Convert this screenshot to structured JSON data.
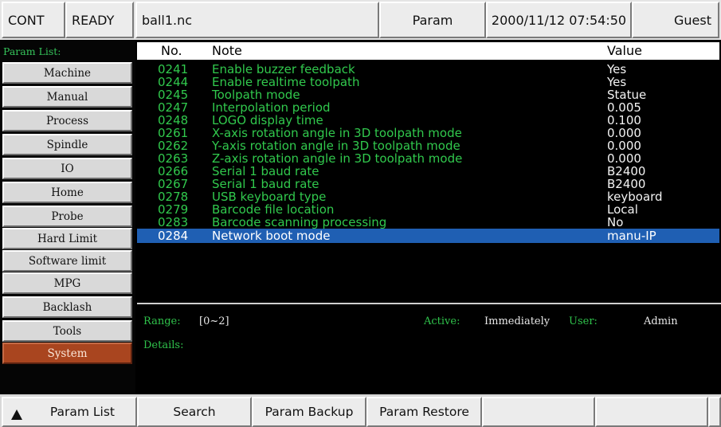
{
  "status_bar": {
    "mode": "CONT",
    "state": "READY",
    "file": "ball1.nc",
    "screen": "Param",
    "datetime": "2000/11/12 07:54:50",
    "user": "Guest"
  },
  "sidebar": {
    "title": "Param List:",
    "items": [
      {
        "label": "Machine"
      },
      {
        "label": "Manual"
      },
      {
        "label": "Process"
      },
      {
        "label": "Spindle"
      },
      {
        "label": "IO"
      },
      {
        "label": "Home"
      },
      {
        "label": "Probe"
      },
      {
        "label": "Hard Limit"
      },
      {
        "label": "Software limit"
      },
      {
        "label": "MPG"
      },
      {
        "label": "Backlash"
      },
      {
        "label": "Tools"
      },
      {
        "label": "System"
      }
    ],
    "active_index": 12
  },
  "table": {
    "headers": {
      "no": "No.",
      "note": "Note",
      "value": "Value"
    },
    "rows": [
      {
        "no": "0241",
        "note": "Enable buzzer feedback",
        "value": "Yes"
      },
      {
        "no": "0244",
        "note": "Enable realtime toolpath",
        "value": "Yes"
      },
      {
        "no": "0245",
        "note": "Toolpath mode",
        "value": "Statue"
      },
      {
        "no": "0247",
        "note": "Interpolation period",
        "value": "0.005"
      },
      {
        "no": "0248",
        "note": "LOGO display time",
        "value": "0.100"
      },
      {
        "no": "0261",
        "note": "X-axis rotation angle in 3D toolpath mode",
        "value": "0.000"
      },
      {
        "no": "0262",
        "note": "Y-axis rotation angle in 3D toolpath mode",
        "value": "0.000"
      },
      {
        "no": "0263",
        "note": "Z-axis rotation angle in 3D toolpath mode",
        "value": "0.000"
      },
      {
        "no": "0266",
        "note": "Serial 1 baud rate",
        "value": "B2400"
      },
      {
        "no": "0267",
        "note": "Serial 1 baud rate",
        "value": "B2400"
      },
      {
        "no": "0278",
        "note": "USB keyboard type",
        "value": "keyboard"
      },
      {
        "no": "0279",
        "note": "Barcode file location",
        "value": "Local"
      },
      {
        "no": "0283",
        "note": "Barcode scanning processing",
        "value": "No"
      },
      {
        "no": "0284",
        "note": "Network boot mode",
        "value": "manu-IP"
      }
    ],
    "selected_index": 13
  },
  "detail": {
    "range_label": "Range:",
    "range_value": "[0~2]",
    "active_label": "Active:",
    "active_value": "Immediately",
    "user_label": "User:",
    "user_value": "Admin",
    "details_label": "Details:"
  },
  "function_keys": [
    "Param List",
    "Search",
    "Param Backup",
    "Param Restore",
    "",
    "",
    ""
  ],
  "colors": {
    "text_green": "#31c94d",
    "selected_row": "#1f5fb3",
    "active_button": "#a9451f"
  }
}
